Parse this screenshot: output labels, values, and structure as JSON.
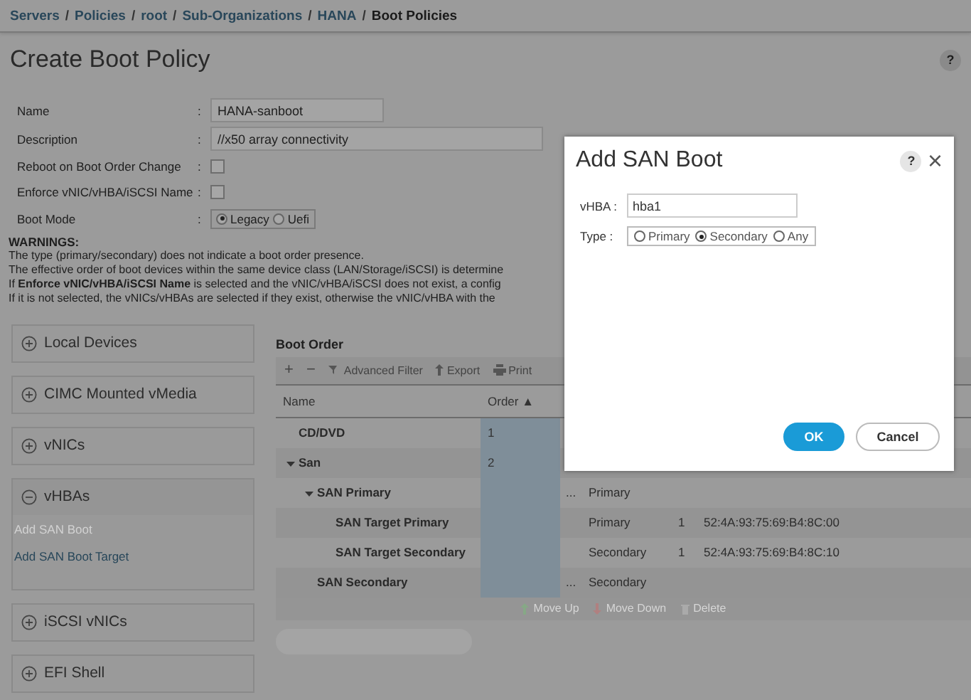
{
  "breadcrumb": {
    "links": [
      "Servers",
      "Policies",
      "root",
      "Sub-Organizations",
      "HANA"
    ],
    "separator": "/",
    "current": "Boot Policies"
  },
  "page": {
    "title": "Create Boot Policy",
    "help": "?"
  },
  "form": {
    "name": {
      "label": "Name",
      "colon": ":",
      "value": "HANA-sanboot"
    },
    "description": {
      "label": "Description",
      "colon": ":",
      "value": "//x50 array connectivity"
    },
    "reboot_on_change": {
      "label": "Reboot on Boot Order Change",
      "colon": ":",
      "checked": false
    },
    "enforce_name": {
      "label": "Enforce vNIC/vHBA/iSCSI Name",
      "colon": ":",
      "checked": false
    },
    "boot_mode": {
      "label": "Boot Mode",
      "colon": ":",
      "options": [
        {
          "label": "Legacy",
          "selected": true
        },
        {
          "label": "Uefi",
          "selected": false
        }
      ]
    }
  },
  "warnings": {
    "title": "WARNINGS:",
    "lines": [
      "The type (primary/secondary) does not indicate a boot order presence.",
      "The effective order of boot devices within the same device class (LAN/Storage/iSCSI) is determine",
      "If **Enforce vNIC/vHBA/iSCSI Name** is selected and the vNIC/vHBA/iSCSI does not exist, a config",
      "If it is not selected, the vNICs/vHBAs are selected if they exist, otherwise the vNIC/vHBA with the"
    ]
  },
  "devices": [
    {
      "label": "Local Devices",
      "expanded": false
    },
    {
      "label": "CIMC Mounted vMedia",
      "expanded": false
    },
    {
      "label": "vNICs",
      "expanded": false
    },
    {
      "label": "vHBAs",
      "expanded": true,
      "links": [
        {
          "label": "Add SAN Boot",
          "disabled": true
        },
        {
          "label": "Add SAN Boot Target",
          "disabled": false
        }
      ]
    },
    {
      "label": "iSCSI vNICs",
      "expanded": false
    },
    {
      "label": "EFI Shell",
      "expanded": false
    }
  ],
  "boot_order": {
    "title": "Boot Order",
    "toolbar": [
      {
        "kind": "add",
        "label": "+"
      },
      {
        "kind": "remove",
        "label": "−"
      },
      {
        "kind": "filter",
        "label": "Advanced Filter"
      },
      {
        "kind": "export",
        "label": "Export"
      },
      {
        "kind": "print",
        "label": "Print"
      }
    ],
    "columns": [
      "Name",
      "Order ▲"
    ],
    "rows": [
      {
        "name": "CD/DVD",
        "order": "1"
      },
      {
        "name": "San",
        "order": "2",
        "expanded": true,
        "children": [
          {
            "name": "SAN Primary",
            "column_3": "...",
            "column_4": "Primary",
            "expanded": true,
            "children": [
              {
                "name": "SAN Target Primary",
                "column_4": "Primary",
                "column_5": "1",
                "column_6": "52:4A:93:75:69:B4:8C:00"
              },
              {
                "name": "SAN Target Secondary",
                "column_4": "Secondary",
                "column_5": "1",
                "column_6": "52:4A:93:75:69:B4:8C:10"
              }
            ]
          },
          {
            "name": "SAN Secondary",
            "column_3": "...",
            "column_4": "Secondary"
          }
        ]
      }
    ],
    "footer": [
      {
        "kind": "up",
        "label": "Move Up"
      },
      {
        "kind": "down",
        "label": "Move Down"
      },
      {
        "kind": "delete",
        "label": "Delete"
      }
    ]
  },
  "dialog": {
    "title": "Add SAN Boot",
    "help": "?",
    "close": "×",
    "vhba": {
      "label": "vHBA :",
      "value": "hba1"
    },
    "type": {
      "label": "Type :",
      "options": [
        {
          "label": "Primary",
          "selected": false
        },
        {
          "label": "Secondary",
          "selected": true
        },
        {
          "label": "Any",
          "selected": false
        }
      ]
    },
    "buttons": [
      {
        "kind": "primary",
        "label": "OK"
      },
      {
        "kind": "secondary",
        "label": "Cancel"
      }
    ]
  }
}
